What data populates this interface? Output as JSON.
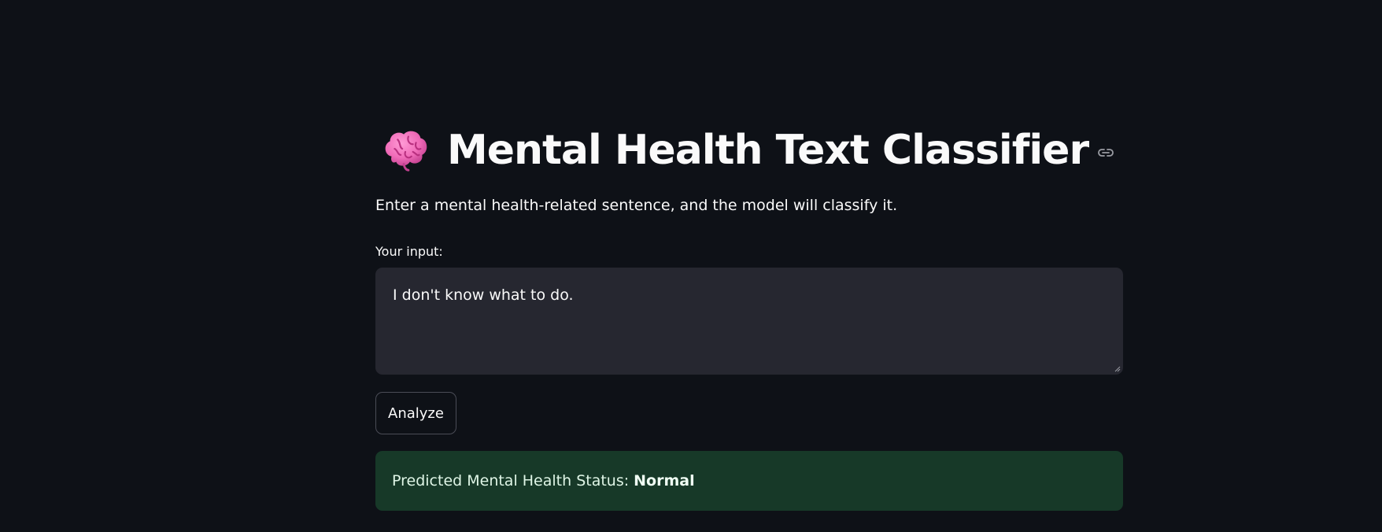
{
  "header": {
    "title": "Mental Health Text Classifier",
    "title_icon": "brain-icon",
    "anchor_icon": "link-icon"
  },
  "intro": {
    "text": "Enter a mental health-related sentence, and the model will classify it."
  },
  "input": {
    "label": "Your input:",
    "value": "I don't know what to do."
  },
  "actions": {
    "analyze_label": "Analyze"
  },
  "result": {
    "prefix": "Predicted Mental Health Status:",
    "value": "Normal"
  },
  "colors": {
    "background": "#0e1117",
    "textarea_background": "#262730",
    "success_background": "#173928",
    "text": "#fafafa"
  }
}
